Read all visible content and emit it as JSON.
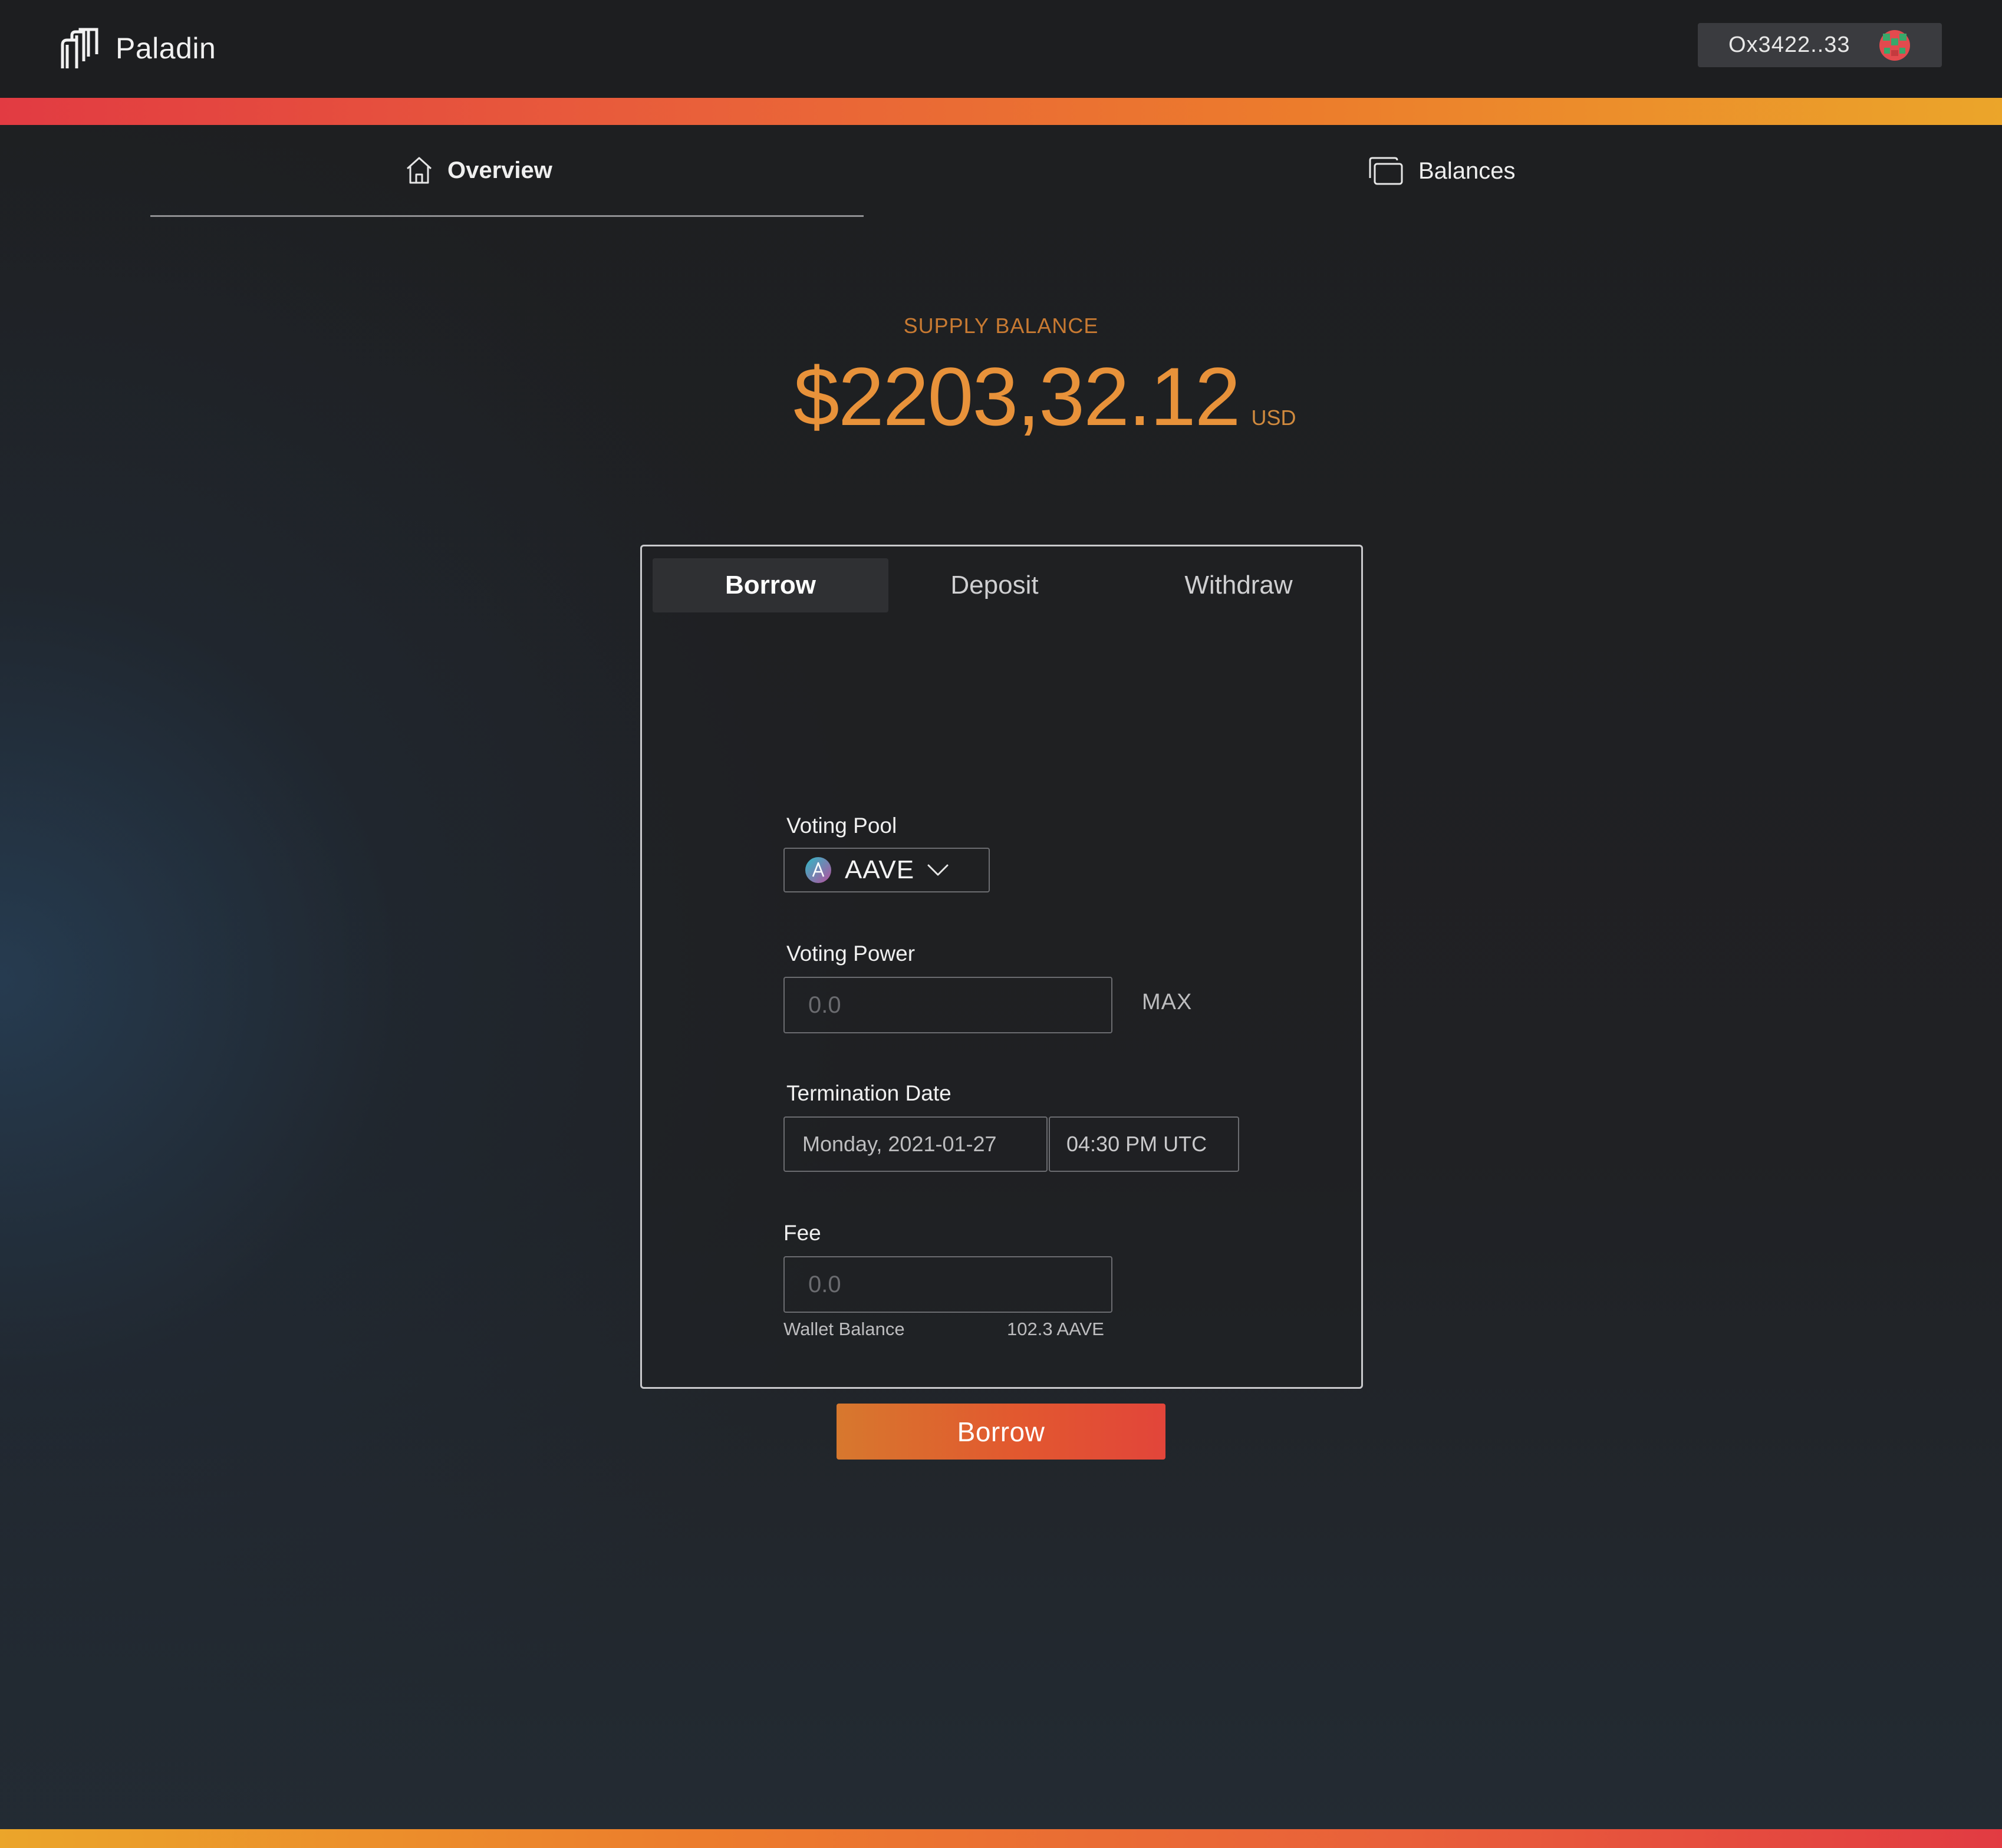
{
  "app": {
    "name": "Paladin",
    "logo_icon": "paladin-logo-icon"
  },
  "wallet": {
    "address": "Ox3422..33",
    "avatar_icon": "wallet-avatar-icon"
  },
  "colors": {
    "accent_orange": "#e8923a",
    "accent_red": "#e23b42",
    "accent_yellow": "#eba52a",
    "background": "#1f2023"
  },
  "nav": {
    "tabs": [
      {
        "label": "Overview",
        "icon": "home-icon",
        "active": true
      },
      {
        "label": "Balances",
        "icon": "stacked-cards-icon",
        "active": false
      }
    ]
  },
  "supply": {
    "label": "SUPPLY BALANCE",
    "amount": "$2203,32.12",
    "currency": "USD"
  },
  "form": {
    "tabs": [
      {
        "label": "Borrow",
        "active": true
      },
      {
        "label": "Deposit",
        "active": false
      },
      {
        "label": "Withdraw",
        "active": false
      }
    ],
    "voting_pool": {
      "label": "Voting Pool",
      "value": "AAVE",
      "icon": "aave-token-icon"
    },
    "voting_power": {
      "label": "Voting Power",
      "placeholder": "0.0",
      "max_label": "MAX"
    },
    "termination_date": {
      "label": "Termination Date",
      "date": "Monday, 2021-01-27",
      "time": "04:30 PM UTC"
    },
    "fee": {
      "label": "Fee",
      "placeholder": "0.0",
      "wallet_balance_label": "Wallet Balance",
      "wallet_balance_value": "102.3 AAVE"
    },
    "submit_label": "Borrow"
  }
}
